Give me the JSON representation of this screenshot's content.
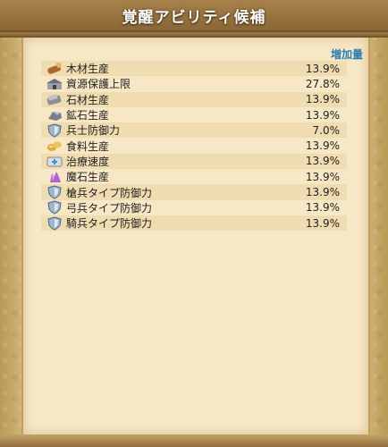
{
  "header": {
    "title": "覚醒アビリティ候補"
  },
  "column_header": "増加量",
  "rows": [
    {
      "icon": "wood-log-icon",
      "label": "木材生産",
      "value": "13.9%"
    },
    {
      "icon": "warehouse-icon",
      "label": "資源保護上限",
      "value": "27.8%"
    },
    {
      "icon": "stone-icon",
      "label": "石材生産",
      "value": "13.9%"
    },
    {
      "icon": "ore-icon",
      "label": "鉱石生産",
      "value": "13.9%"
    },
    {
      "icon": "shield-icon",
      "label": "兵士防御力",
      "value": "7.0%"
    },
    {
      "icon": "food-icon",
      "label": "食料生産",
      "value": "13.9%"
    },
    {
      "icon": "medkit-icon",
      "label": "治療速度",
      "value": "13.9%"
    },
    {
      "icon": "crystal-icon",
      "label": "魔石生産",
      "value": "13.9%"
    },
    {
      "icon": "shield-icon",
      "label": "槍兵タイプ防御力",
      "value": "13.9%"
    },
    {
      "icon": "shield-icon",
      "label": "弓兵タイプ防御力",
      "value": "13.9%"
    },
    {
      "icon": "shield-icon",
      "label": "騎兵タイプ防御力",
      "value": "13.9%"
    }
  ]
}
